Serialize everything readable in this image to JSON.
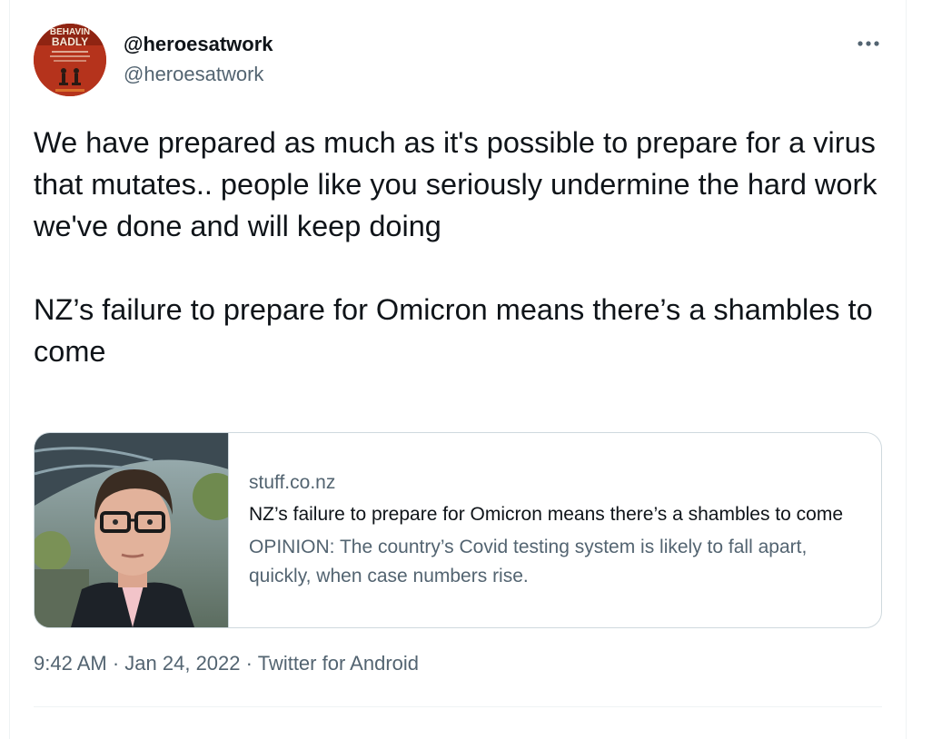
{
  "author": {
    "display_name": "@heroesatwork",
    "username": "@heroesatwork",
    "avatar_icon": "book-cover-avatar",
    "avatar_lettering": [
      "BEHAVIN",
      "BADLY"
    ]
  },
  "more_icon": "more-horizontal-icon",
  "tweet": {
    "text": "We have prepared as much as it's possible to prepare for a virus that mutates.. people like you seriously undermine the hard work we've done and will keep doing\n\nNZ’s failure to prepare for Omicron means there’s a shambles to come"
  },
  "link_card": {
    "domain": "stuff.co.nz",
    "title": "NZ’s failure to prepare for Omicron means there’s a shambles to come",
    "description": "OPINION: The country’s Covid testing system is likely to fall apart, quickly, when case numbers rise.",
    "thumbnail_icon": "article-photo-thumbnail"
  },
  "meta": {
    "time": "9:42 AM",
    "separator": "·",
    "date": "Jan 24, 2022",
    "source": "Twitter for Android"
  },
  "colors": {
    "text_primary": "#0f1419",
    "text_secondary": "#536471",
    "border": "#cfd9de",
    "divider": "#eff3f4"
  }
}
